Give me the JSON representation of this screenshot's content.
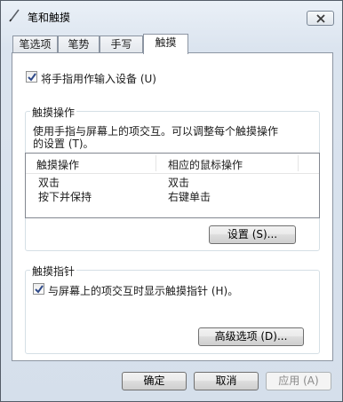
{
  "window": {
    "title": "笔和触摸",
    "close_label": "×"
  },
  "tabs": [
    {
      "label": "笔选项",
      "active": false
    },
    {
      "label": "笔势",
      "active": false
    },
    {
      "label": "手写",
      "active": false
    },
    {
      "label": "触摸",
      "active": true
    }
  ],
  "touch_input": {
    "label": "将手指用作输入设备 (U)",
    "checked": true
  },
  "touch_actions": {
    "group_title": "触摸操作",
    "description_line1": "使用手指与屏幕上的项交互。可以调整每个触摸操作",
    "description_line2": "的设置 (T)。",
    "columns": [
      "触摸操作",
      "相应的鼠标操作"
    ],
    "rows": [
      {
        "action": "双击",
        "mouse": "双击"
      },
      {
        "action": "按下并保持",
        "mouse": "右键单击"
      }
    ],
    "settings_button": "设置 (S)..."
  },
  "touch_pointer": {
    "group_title": "触摸指针",
    "checkbox_label": "与屏幕上的项交互时显示触摸指针 (H)。",
    "checked": true,
    "advanced_button": "高级选项 (D)..."
  },
  "footer": {
    "ok": "确定",
    "cancel": "取消",
    "apply": "应用 (A)"
  }
}
